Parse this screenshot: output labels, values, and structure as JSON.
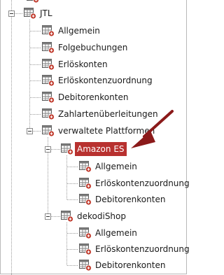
{
  "tree": {
    "root": {
      "label": "JTL",
      "expanded": true
    },
    "jtl_children": [
      "Allgemein",
      "Folgebuchungen",
      "Erlöskonten",
      "Erlöskontenzuordnung",
      "Debitorenkonten",
      "Zahlartenüberleitungen"
    ],
    "platforms": {
      "label": "verwaltete Plattformen",
      "expanded": true
    },
    "amazon": {
      "label": "Amazon ES",
      "selected": true,
      "children": [
        "Allgemein",
        "Erlöskontenzuordnung",
        "Debitorenkonten"
      ]
    },
    "dekodi": {
      "label": "dekodiShop",
      "children": [
        "Allgemein",
        "Erlöskontenzuordnung",
        "Debitorenkonten"
      ]
    }
  },
  "icon": "table-settings-icon",
  "colors": {
    "selection": "#b8312f",
    "arrow": "#8b1a1a",
    "tree_lines": "#9a9a9a",
    "icon_badge": "#c0392b"
  }
}
